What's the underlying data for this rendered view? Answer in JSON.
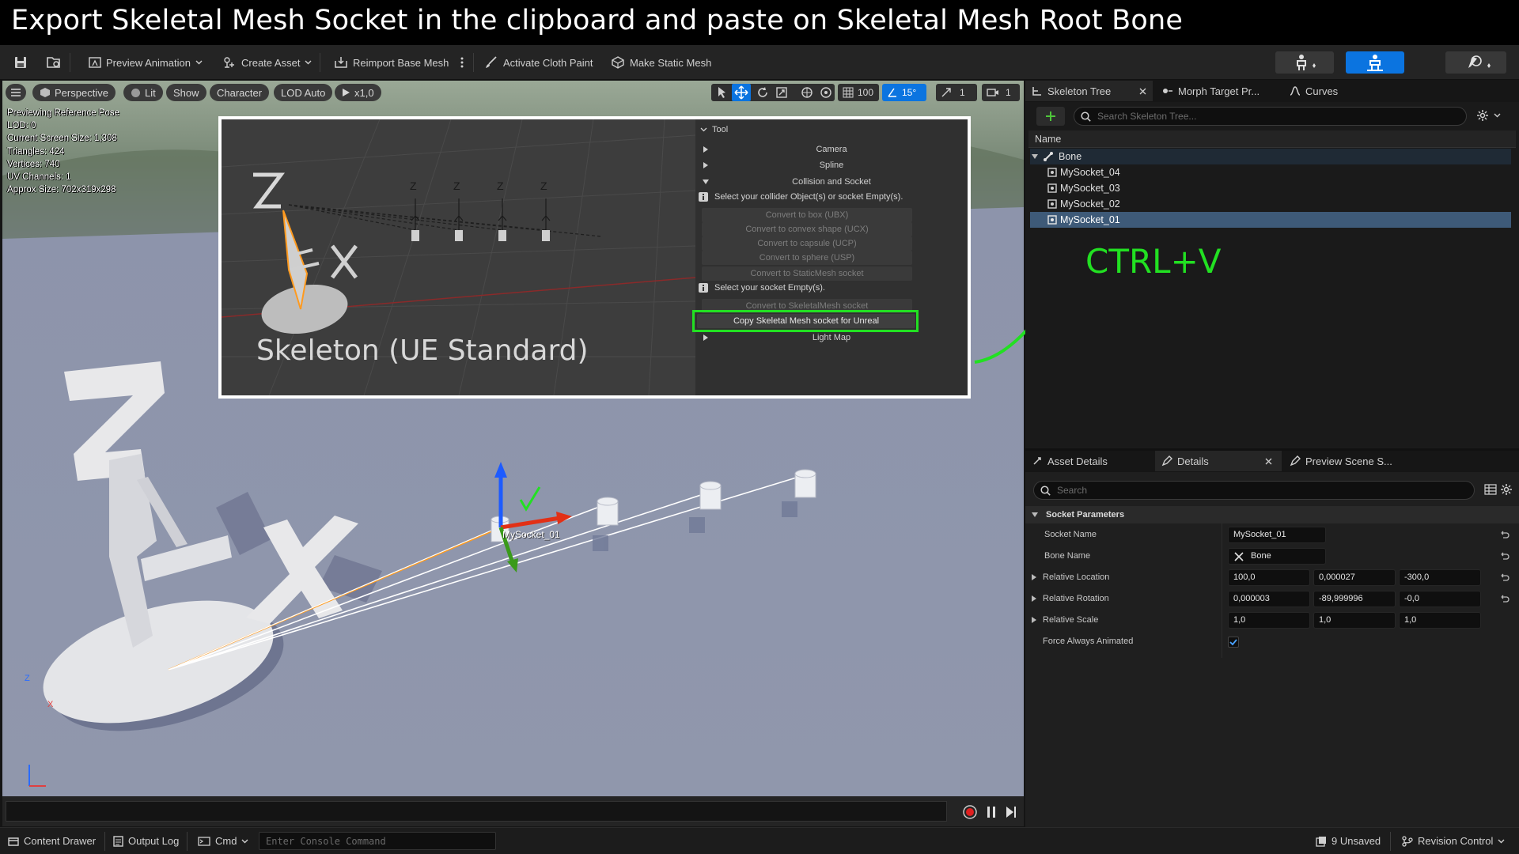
{
  "title": "Export Skeletal Mesh Socket in the clipboard and paste on Skeletal Mesh Root Bone",
  "toolbar": {
    "preview_animation": "Preview Animation",
    "create_asset": "Create Asset",
    "reimport": "Reimport Base Mesh",
    "activate_cloth": "Activate Cloth Paint",
    "make_static": "Make Static Mesh"
  },
  "viewport": {
    "perspective": "Perspective",
    "lit": "Lit",
    "show": "Show",
    "character": "Character",
    "lod": "LOD Auto",
    "speed": "x1,0",
    "grid_value": "100",
    "angle_value": "15°",
    "scale_value": "1",
    "camera_value": "1",
    "stats": [
      "Previewing Reference Pose",
      "LOD: 0",
      "Current Screen Size: 1,308",
      "Triangles: 424",
      "Vertices: 740",
      "UV Channels: 1",
      "Approx Size: 702x319x298"
    ],
    "socket_label": "MySocket_01",
    "axis_z": "Z",
    "axis_x": "X"
  },
  "inset": {
    "caption": "Skeleton (UE Standard)",
    "panel_title": "Tool",
    "sections": [
      "Camera",
      "Spline",
      "Collision and Socket"
    ],
    "info1": "Select your collider Object(s) or socket Empty(s).",
    "buttons1": [
      "Convert to box (UBX)",
      "Convert to convex shape (UCX)",
      "Convert to capsule (UCP)",
      "Convert to sphere (USP)",
      "Convert to StaticMesh socket"
    ],
    "info2": "Select your socket Empty(s).",
    "button_skeletal": "Convert to SkeletalMesh socket",
    "button_copy": "Copy Skeletal Mesh socket for Unreal",
    "light_map": "Light Map",
    "axis_labels": [
      "Z",
      "Z",
      "Z",
      "Z"
    ]
  },
  "annotation": {
    "shortcut": "CTRL+V",
    "color": "#22e022"
  },
  "skeleton_tree": {
    "tabs": [
      "Skeleton Tree",
      "Morph Target Pr...",
      "Curves"
    ],
    "search_placeholder": "Search Skeleton Tree...",
    "column": "Name",
    "root": "Bone",
    "sockets": [
      "MySocket_04",
      "MySocket_03",
      "MySocket_02",
      "MySocket_01"
    ],
    "selected": "MySocket_01"
  },
  "details": {
    "tabs": [
      "Asset Details",
      "Details",
      "Preview Scene S..."
    ],
    "search_placeholder": "Search",
    "section": "Socket Parameters",
    "socket_name_label": "Socket Name",
    "socket_name": "MySocket_01",
    "bone_name_label": "Bone Name",
    "bone_name": "Bone",
    "location_label": "Relative Location",
    "location": [
      "100,0",
      "0,000027",
      "-300,0"
    ],
    "rotation_label": "Relative Rotation",
    "rotation": [
      "0,000003",
      "-89,999996",
      "-0,0"
    ],
    "scale_label": "Relative Scale",
    "scale": [
      "1,0",
      "1,0",
      "1,0"
    ],
    "force_label": "Force Always Animated",
    "force_checked": true
  },
  "statusbar": {
    "content_drawer": "Content Drawer",
    "output_log": "Output Log",
    "cmd": "Cmd",
    "console_placeholder": "Enter Console Command",
    "unsaved": "9 Unsaved",
    "revision": "Revision Control"
  }
}
